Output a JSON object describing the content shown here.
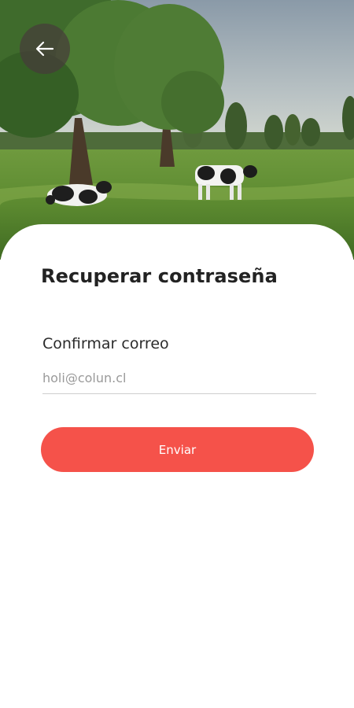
{
  "header": {
    "back_icon": "arrow-left-icon",
    "hero_image": "pasture-with-cows"
  },
  "form": {
    "title": "Recuperar contraseña",
    "email_label": "Confirmar correo",
    "email_placeholder": "holi@colun.cl",
    "email_value": "",
    "submit_label": "Enviar"
  },
  "colors": {
    "accent": "#f5524a",
    "sheet": "#ffffff",
    "title_text": "#222222",
    "placeholder": "#9a9a9a"
  }
}
